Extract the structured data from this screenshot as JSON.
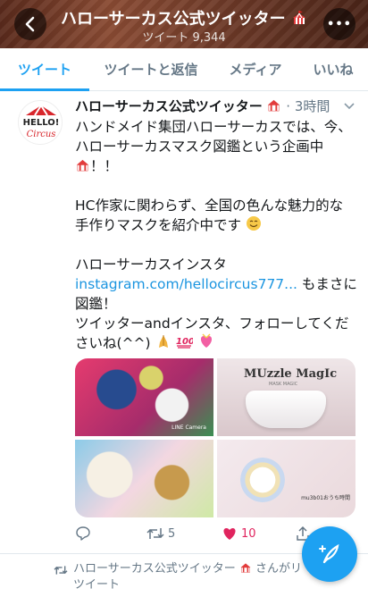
{
  "header": {
    "title": "ハローサーカス公式ツイッター",
    "subtitle": "ツイート 9,344",
    "back_icon": "chevron-left-icon",
    "more_icon": "more-horizontal-icon",
    "more_label": "•••"
  },
  "tabs": [
    {
      "label": "ツイート",
      "active": true
    },
    {
      "label": "ツイートと返信",
      "active": false
    },
    {
      "label": "メディア",
      "active": false
    },
    {
      "label": "いいね",
      "active": false
    }
  ],
  "tweet": {
    "avatar": {
      "text_top": "HELLO!",
      "text_bottom": "Circus"
    },
    "author": "ハローサーカス公式ツイッター",
    "separator": "·",
    "time": "3時間",
    "body": {
      "line1": "ハンドメイド集団ハローサーカスでは、今、",
      "line2": "ハローサーカスマスク図鑑という企画中",
      "line3": "！！",
      "line4": "HC作家に関わらず、全国の色んな魅力的な",
      "line5": "手作りマスクを紹介中です",
      "line6": "ハローサーカスインスタ",
      "link": "instagram.com/hellocircus777...",
      "line7_after_link": " もまさに",
      "line8": "図鑑！",
      "line9": "ツイッターandインスタ、フォローしてくだ",
      "line10": "さいね(^^)"
    },
    "media": {
      "image2_title": "MUzzle MagIc",
      "image2_sub": "MASK MAGIC",
      "image1_caption": "LINE Camera",
      "image4_caption": "mu3b01おうち時間"
    },
    "actions": {
      "reply_count": "",
      "retweet_count": "5",
      "like_count": "10"
    }
  },
  "next_tweet": {
    "retweeter": "ハローサーカス公式ツイッター",
    "suffix": "さんがリ",
    "line2": "ツイート"
  },
  "colors": {
    "accent": "#1da1f2",
    "like": "#e0245e",
    "link": "#1b95e0",
    "muted": "#657786"
  }
}
